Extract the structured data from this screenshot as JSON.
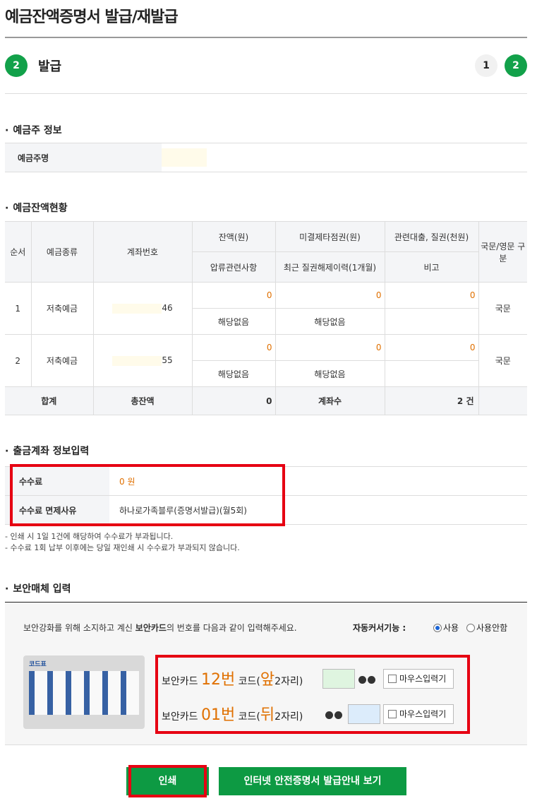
{
  "page": {
    "title": "예금잔액증명서 발급/재발급",
    "step_number": "2",
    "step_label": "발급",
    "steps": [
      "1",
      "2"
    ]
  },
  "holder": {
    "section_title": "예금주 정보",
    "label": "예금주명"
  },
  "balance": {
    "section_title": "예금잔액현황",
    "headers": {
      "seq": "순서",
      "type": "예금종류",
      "account": "계좌번호",
      "balance": "잔액(원)",
      "unsettled": "미결제타점권(원)",
      "loan": "관련대출, 질권(천원)",
      "lang": "국문/영문 구분",
      "seizure": "압류관련사항",
      "pledge": "최근 질권해제이력(1개월)",
      "remark": "비고"
    },
    "rows": [
      {
        "seq": "1",
        "type": "저축예금",
        "account_tail": "46",
        "balance": "0",
        "unsettled": "0",
        "loan": "0",
        "seizure": "해당없음",
        "pledge": "해당없음",
        "remark": "",
        "lang": "국문"
      },
      {
        "seq": "2",
        "type": "저축예금",
        "account_tail": "55",
        "balance": "0",
        "unsettled": "0",
        "loan": "0",
        "seizure": "해당없음",
        "pledge": "해당없음",
        "remark": "",
        "lang": "국문"
      }
    ],
    "summary": {
      "total_label": "합계",
      "total_balance_label": "총잔액",
      "total_balance": "0",
      "account_count_label": "계좌수",
      "account_count": "2 건"
    }
  },
  "withdraw": {
    "section_title": "출금계좌 정보입력",
    "fee_label": "수수료",
    "fee_value": "0 원",
    "exempt_label": "수수료 면제사유",
    "exempt_value": "하나로가족블루(증명서발급)(월5회)",
    "notes": [
      "- 인쇄 시 1일 1건에 해당하여 수수료가 부과됩니다.",
      "- 수수료 1회 납부 이후에는 당일 재인쇄 시 수수료가 부과되지 않습니다."
    ]
  },
  "security": {
    "section_title": "보안매체 입력",
    "instruction_prefix": "보안강화를 위해 소지하고 계신 ",
    "instruction_bold": "보안카드",
    "instruction_suffix": "의 번호를 다음과 같이 입력해주세요.",
    "auto_cursor_label": "자동커서기능 :",
    "radio_use": "사용",
    "radio_nouse": "사용안함",
    "card_title": "코드표",
    "row1": {
      "prefix": "보안카드 ",
      "num": "12번",
      "code": " 코드(",
      "pos": "앞",
      "digits": "2자리)"
    },
    "row2": {
      "prefix": "보안카드 ",
      "num": "01번",
      "code": " 코드(",
      "pos": "뒤",
      "digits": "2자리)"
    },
    "mouse_input": "마우스입력기"
  },
  "buttons": {
    "print": "인쇄",
    "guide": "인터넷 안전증명서 발급안내 보기"
  },
  "colors": {
    "accent_green": "#12a14a",
    "highlight_red": "#e60012",
    "amount_orange": "#e07000"
  }
}
